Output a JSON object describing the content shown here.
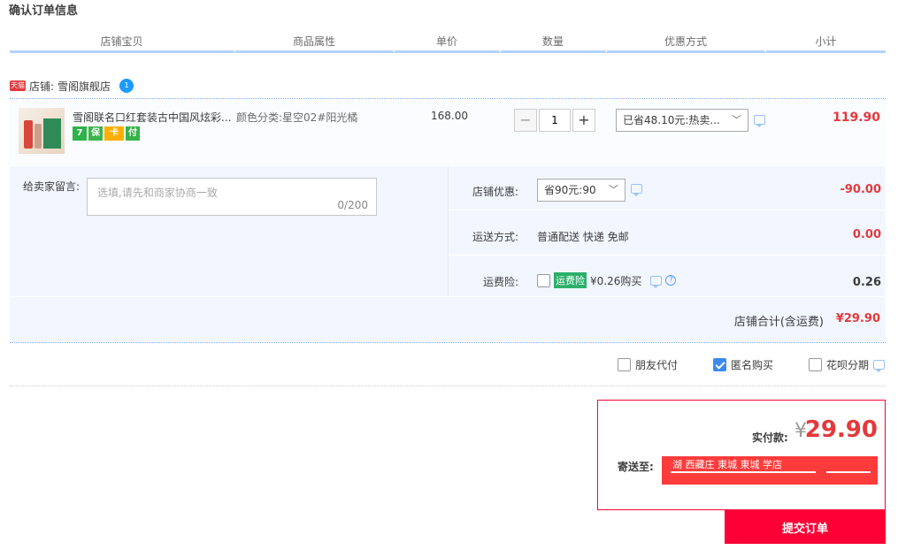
{
  "page": {
    "title": "确认订单信息"
  },
  "columns": [
    "店铺宝贝",
    "商品属性",
    "单价",
    "数量",
    "优惠方式",
    "小计"
  ],
  "shop": {
    "badge": "天猫",
    "label": "店铺:",
    "name": "雪阁旗舰店",
    "ww_badge": "1"
  },
  "item": {
    "name": "雪阁联名口红套装古中国风炫彩...",
    "badges": [
      "7",
      "保",
      "卡",
      "付"
    ],
    "sku_label": "颜色分类:",
    "sku_value": "星空02#阳光橘",
    "price": "168.00",
    "qty_minus": "−",
    "quantity": "1",
    "qty_plus": "+",
    "promo_selected": "已省48.10元:热卖...",
    "subtotal": "119.90"
  },
  "message": {
    "label": "给卖家留言:",
    "placeholder": "选填,请先和商家协商一致",
    "count": "0/200"
  },
  "shop_promo": {
    "label": "店铺优惠:",
    "selected": "省90元:90",
    "value": "-90.00",
    "value_color": "#e4393c"
  },
  "shipping": {
    "label": "运送方式:",
    "method": "普通配送 快递 免邮",
    "value": "0.00",
    "value_color": "#e4393c"
  },
  "insurance": {
    "label": "运费险:",
    "checked": false,
    "tag": "运费险",
    "price_text": "¥0.26购买",
    "help": "?",
    "value": "0.26",
    "value_color": "#3c3c3c"
  },
  "shop_total": {
    "label": "店铺合计(含运费)",
    "value": "¥29.90"
  },
  "options": [
    {
      "label": "朋友代付",
      "checked": false
    },
    {
      "label": "匿名购买",
      "checked": true
    },
    {
      "label": "花呗分期",
      "checked": false
    }
  ],
  "summary": {
    "pay_label": "实付款:",
    "currency": "¥",
    "pay_value": "29.90",
    "ship_label": "寄送至:",
    "address": "湖 西藏庄 東城 東城 学店"
  },
  "submit_label": "提交订单",
  "colors": {
    "accent": "#ff0036",
    "price": "#e4393c",
    "border_blue": "#b2d1ff",
    "row_bg": "#f2f7ff"
  }
}
